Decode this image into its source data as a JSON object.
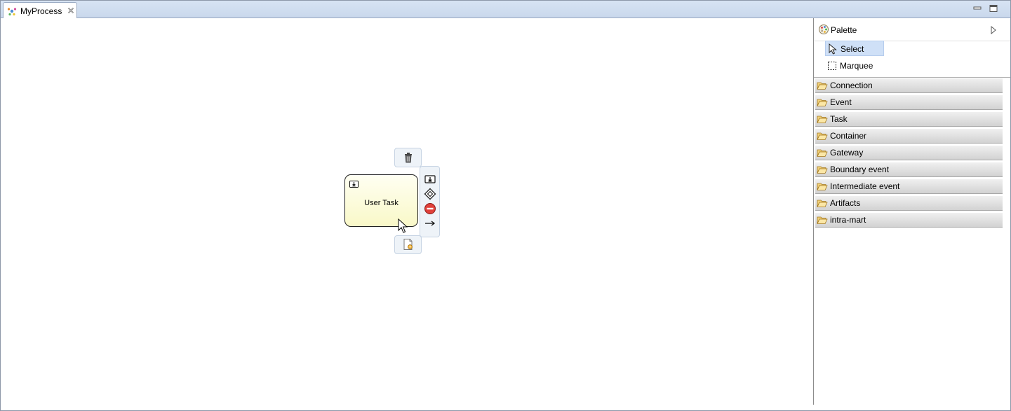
{
  "editor_tab": {
    "title": "MyProcess",
    "icon": "process-icon",
    "close_icon": "close-icon"
  },
  "window_controls": [
    "minimize-icon",
    "maximize-icon"
  ],
  "canvas": {
    "task": {
      "label": "User Task",
      "type_icon": "user-task-icon"
    },
    "context_buttons": [
      "delete-icon",
      "user-task-icon",
      "gateway-icon",
      "end-event-icon",
      "sequence-flow-arrow-icon",
      "properties-icon"
    ]
  },
  "palette": {
    "title": "Palette",
    "tools": [
      {
        "label": "Select",
        "icon": "select-arrow-icon",
        "selected": true
      },
      {
        "label": "Marquee",
        "icon": "marquee-icon",
        "selected": false
      }
    ],
    "drawers": [
      {
        "label": "Connection"
      },
      {
        "label": "Event"
      },
      {
        "label": "Task"
      },
      {
        "label": "Container"
      },
      {
        "label": "Gateway"
      },
      {
        "label": "Boundary event"
      },
      {
        "label": "Intermediate event"
      },
      {
        "label": "Artifacts"
      },
      {
        "label": "intra-mart"
      }
    ]
  },
  "colors": {
    "tabbar": "#c9d8ec",
    "task_fill": "#f9f8c8",
    "selected_tool": "#cfe0f7",
    "drawer": "#d2d2d2",
    "end_event": "#e0403a"
  }
}
